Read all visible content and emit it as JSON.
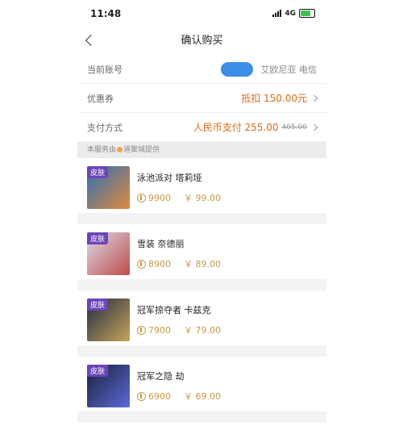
{
  "status_bar": {
    "time": "11:48",
    "network": "4G"
  },
  "nav": {
    "title": "确认购买"
  },
  "rows": {
    "account": {
      "label": "当前账号",
      "value": "艾欧尼亚 电信"
    },
    "coupon": {
      "label": "优惠券",
      "value": "抵扣 150.00元"
    },
    "payment": {
      "label": "支付方式",
      "value": "人民币支付 255.00",
      "original": "405.00"
    }
  },
  "provider": {
    "prefix": "本服务由",
    "suffix": "道聚城提供"
  },
  "skins": [
    {
      "tag": "皮肤",
      "name": "泳池派对 塔莉垭",
      "points": "9900",
      "price": "￥ 99.00",
      "thumb_colors": [
        "#2a6fb5",
        "#e28a3b"
      ]
    },
    {
      "tag": "皮肤",
      "name": "雪装 奈德丽",
      "points": "8900",
      "price": "￥ 89.00",
      "thumb_colors": [
        "#d9dde6",
        "#c04b4b"
      ]
    },
    {
      "tag": "皮肤",
      "name": "冠军掠夺者 卡兹克",
      "points": "7900",
      "price": "￥ 79.00",
      "thumb_colors": [
        "#1e2a40",
        "#c8a45a"
      ]
    },
    {
      "tag": "皮肤",
      "name": "冠军之隐 劫",
      "points": "6900",
      "price": "￥ 69.00",
      "thumb_colors": [
        "#1a1f3a",
        "#5b6bd8"
      ]
    }
  ],
  "colors": {
    "accent": "#e06a15",
    "coin": "#c79a47",
    "tag": "#6b45b8"
  }
}
